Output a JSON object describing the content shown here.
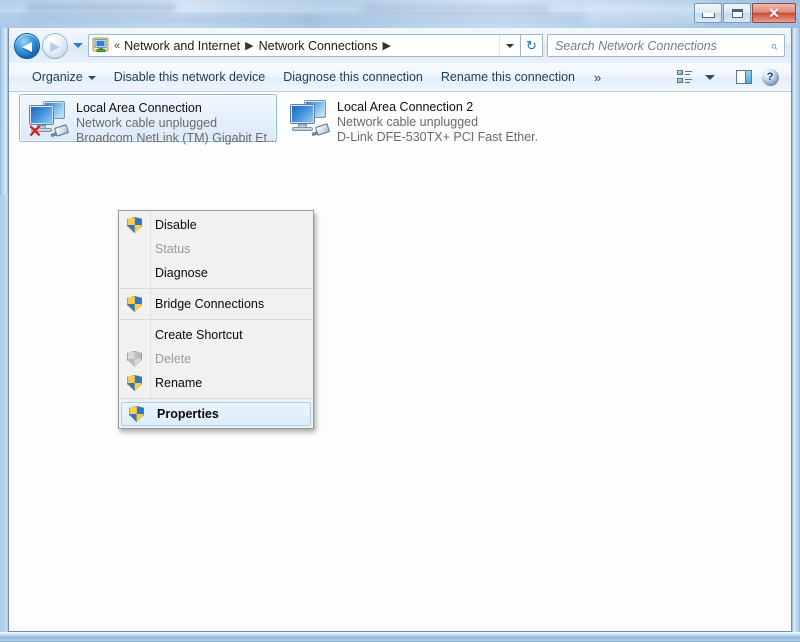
{
  "window": {
    "controls": {
      "minimize": "minimize-button",
      "maximize": "maximize-button",
      "close_glyph": "✕"
    }
  },
  "addressbar": {
    "back_glyph": "◀",
    "forward_glyph": "▶",
    "crumb_chevrons": "«",
    "crumbs": [
      {
        "label": "Network and Internet",
        "sep": "▶"
      },
      {
        "label": "Network Connections",
        "sep": "▶"
      }
    ],
    "refresh_glyph": "↻"
  },
  "search": {
    "placeholder": "Search Network Connections",
    "value": "",
    "icon": "search-icon"
  },
  "toolbar": {
    "organize_label": "Organize",
    "items": [
      "Disable this network device",
      "Diagnose this connection",
      "Rename this connection"
    ],
    "more_label": "»",
    "help_glyph": "?"
  },
  "connections": [
    {
      "name": "Local Area Connection",
      "status": "Network cable unplugged",
      "adapter": "Broadcom NetLink (TM) Gigabit Et...",
      "selected": true,
      "disabled_x": "✕"
    },
    {
      "name": "Local Area Connection 2",
      "status": "Network cable unplugged",
      "adapter": "D-Link DFE-530TX+ PCI Fast Ether...",
      "selected": false,
      "disabled_x": ""
    }
  ],
  "context_menu": {
    "items": [
      {
        "label": "Disable",
        "icon": "shield-icon",
        "disabled": false,
        "bold": false,
        "highlight": false,
        "sep_after": false
      },
      {
        "label": "Status",
        "icon": "none",
        "disabled": true,
        "bold": false,
        "highlight": false,
        "sep_after": false
      },
      {
        "label": "Diagnose",
        "icon": "none",
        "disabled": false,
        "bold": false,
        "highlight": false,
        "sep_after": true
      },
      {
        "label": "Bridge Connections",
        "icon": "shield-icon",
        "disabled": false,
        "bold": false,
        "highlight": false,
        "sep_after": true
      },
      {
        "label": "Create Shortcut",
        "icon": "none",
        "disabled": false,
        "bold": false,
        "highlight": false,
        "sep_after": false
      },
      {
        "label": "Delete",
        "icon": "shield-icon-gray",
        "disabled": true,
        "bold": false,
        "highlight": false,
        "sep_after": false
      },
      {
        "label": "Rename",
        "icon": "shield-icon",
        "disabled": false,
        "bold": false,
        "highlight": false,
        "sep_after": true
      },
      {
        "label": "Properties",
        "icon": "shield-icon",
        "disabled": false,
        "bold": true,
        "highlight": true,
        "sep_after": false
      }
    ]
  },
  "colors": {
    "accent": "#2f76c4",
    "selection_border": "#8cb8dd",
    "highlight_bg": "#dcedfb",
    "error_x": "#d31f1f"
  }
}
